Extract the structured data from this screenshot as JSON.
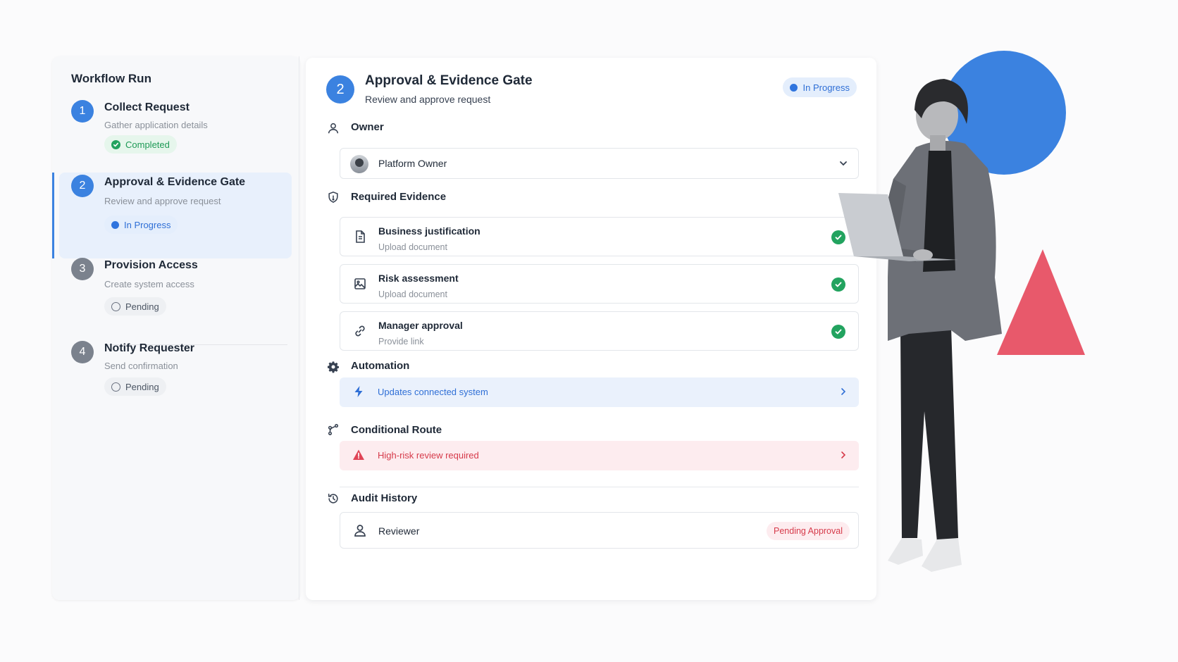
{
  "sidebar": {
    "title": "Workflow Run",
    "steps": [
      {
        "number": "1",
        "title": "Collect Request",
        "subtitle": "Gather application details",
        "status": "Completed"
      },
      {
        "number": "2",
        "title": "Approval & Evidence Gate",
        "subtitle": "Review and approve request",
        "status": "In Progress"
      },
      {
        "number": "3",
        "title": "Provision Access",
        "subtitle": "Create system access",
        "status": "Pending"
      },
      {
        "number": "4",
        "title": "Notify Requester",
        "subtitle": "Send confirmation",
        "status": "Pending"
      }
    ]
  },
  "detail": {
    "number": "2",
    "title": "Approval & Evidence Gate",
    "subtitle": "Review and approve request",
    "status": "In Progress",
    "owner": {
      "label": "Owner",
      "value": "Platform Owner"
    },
    "evidence": {
      "label": "Required Evidence",
      "items": [
        {
          "title": "Business justification",
          "action": "Upload document",
          "icon": "document-icon"
        },
        {
          "title": "Risk assessment",
          "action": "Upload document",
          "icon": "image-icon"
        },
        {
          "title": "Manager approval",
          "action": "Provide link",
          "icon": "link-icon"
        }
      ]
    },
    "automation": {
      "label": "Automation",
      "text": "Updates connected system"
    },
    "route": {
      "label": "Conditional Route",
      "text": "High-risk review required"
    },
    "audit": {
      "label": "Audit History",
      "actor": "Reviewer",
      "status": "Pending Approval"
    }
  },
  "colors": {
    "primary": "#3b82e0",
    "success": "#22a35f",
    "danger": "#d63a4a",
    "shape_red": "#e8596b"
  }
}
